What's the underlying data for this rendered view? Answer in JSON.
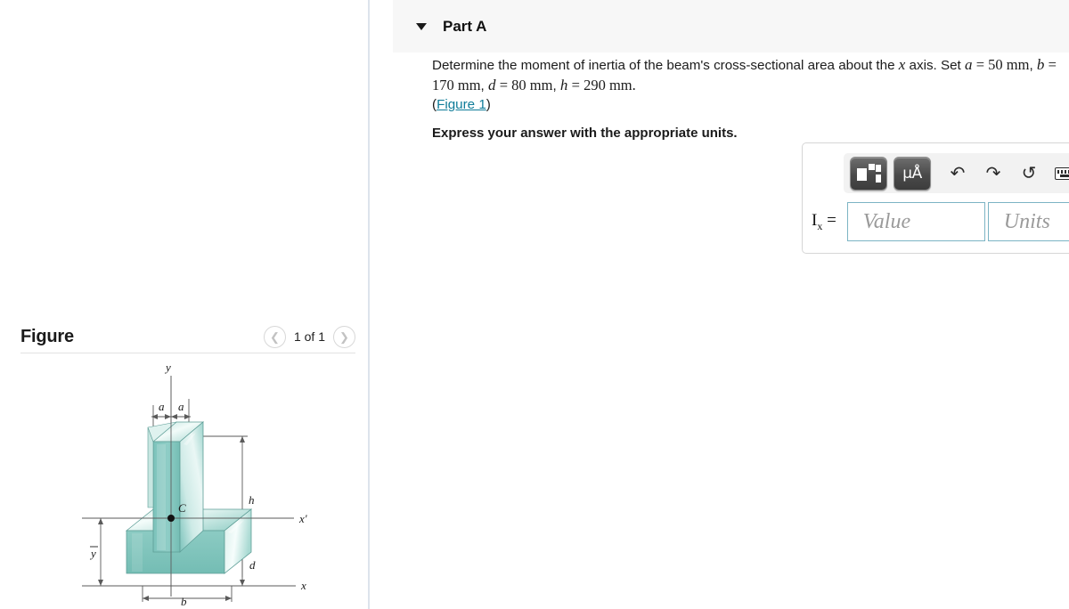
{
  "left_pane": {
    "figure_title": "Figure",
    "nav": {
      "prev_icon": "chevron-left-icon",
      "next_icon": "chevron-right-icon",
      "counter": "1 of 1"
    },
    "diagram": {
      "description": "3D isometric view of an inverted-T beam cross section",
      "color_top": "#d4eae6",
      "color_front": "#7dc4bc",
      "color_side": "#9fd5ce",
      "labels": {
        "y_axis": "y",
        "x_axis": "x",
        "x_prime_axis": "x'",
        "centroid": "C",
        "a_left": "a",
        "a_right": "a",
        "h": "h",
        "d": "d",
        "b": "b",
        "y_bar": "y"
      }
    }
  },
  "right_pane": {
    "part_header": {
      "collapse_icon": "triangle-down-icon",
      "title": "Part A"
    },
    "question": {
      "lead": "Determine the moment of inertia of the beam's cross-sectional area about the ",
      "axis_var": "x",
      "mid": " axis. Set ",
      "var_a": "a",
      "val_a": "= 50 mm",
      "sep1": ", ",
      "var_b": "b",
      "val_b": "= 170 mm",
      "sep2": ", ",
      "var_d": "d",
      "val_d": "= 80 mm",
      "sep3": ", ",
      "var_h": "h",
      "val_h": "= 290 mm",
      "period": ".",
      "figure_link_open": "(",
      "figure_link": "Figure 1",
      "figure_link_close": ")",
      "instruction": "Express your answer with the appropriate units."
    },
    "answer": {
      "toolbar": {
        "template_button": "math-template",
        "units_button": "μÅ",
        "undo_icon": "↶",
        "redo_icon": "↷",
        "reset_icon": "↺",
        "keyboard_icon": "keyboard",
        "help_icon": "?"
      },
      "label": "I",
      "label_sub": "x",
      "label_eq": " =",
      "value_placeholder": "Value",
      "units_placeholder": "Units"
    }
  },
  "theme": {
    "link_color": "#0f7c99",
    "input_border": "#7cb4c4",
    "header_bg": "#f7f7f7",
    "divider": "#dde3ec"
  }
}
